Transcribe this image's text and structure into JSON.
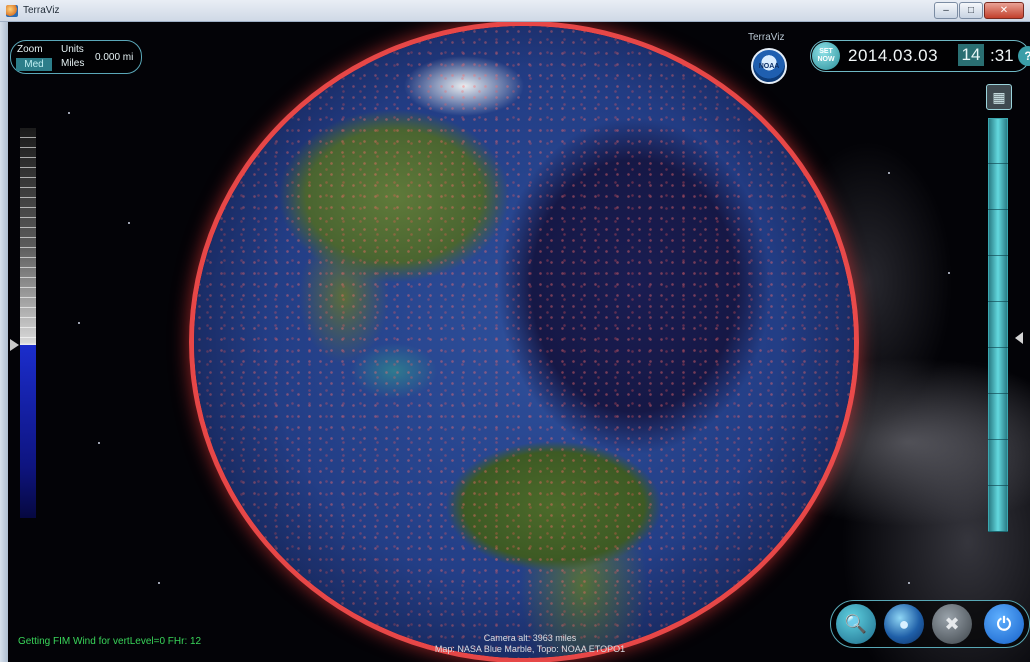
{
  "window": {
    "title": "TerraViz",
    "controls": {
      "minimize": "–",
      "maximize": "□",
      "close": "✕"
    }
  },
  "zoom_panel": {
    "zoom_label": "Zoom",
    "zoom_level": "Med",
    "units_label": "Units",
    "units_value": "Miles",
    "distance_value": "0.000 mi"
  },
  "brand": {
    "app_label": "TerraViz",
    "logo_text": "NOAA",
    "logo_icon": "noaa-logo-icon"
  },
  "datetime": {
    "set_now_label": "SET NOW",
    "date": "2014.03.03",
    "hour": "14",
    "minute": ":31",
    "help_label": "?"
  },
  "altitude_slider": {
    "level_percent": 45
  },
  "time_slider": {
    "position_percent": 54,
    "button_icon": "layer-icon"
  },
  "status": {
    "message": "Getting FIM Wind for vertLevel=0 FHr: 12",
    "camera_altitude": "Camera alt: 3963 miles",
    "map_credit": "Map: NASA Blue Marble, Topo: NOAA ETOPO1"
  },
  "toolbar": {
    "search_icon": "🔍",
    "globe_icon": "●",
    "tools_icon": "✖",
    "power_icon": "⏻"
  },
  "colors": {
    "accent": "#5aa7b8",
    "status_text": "#39d65a",
    "data_points": "#ff6a6a"
  }
}
